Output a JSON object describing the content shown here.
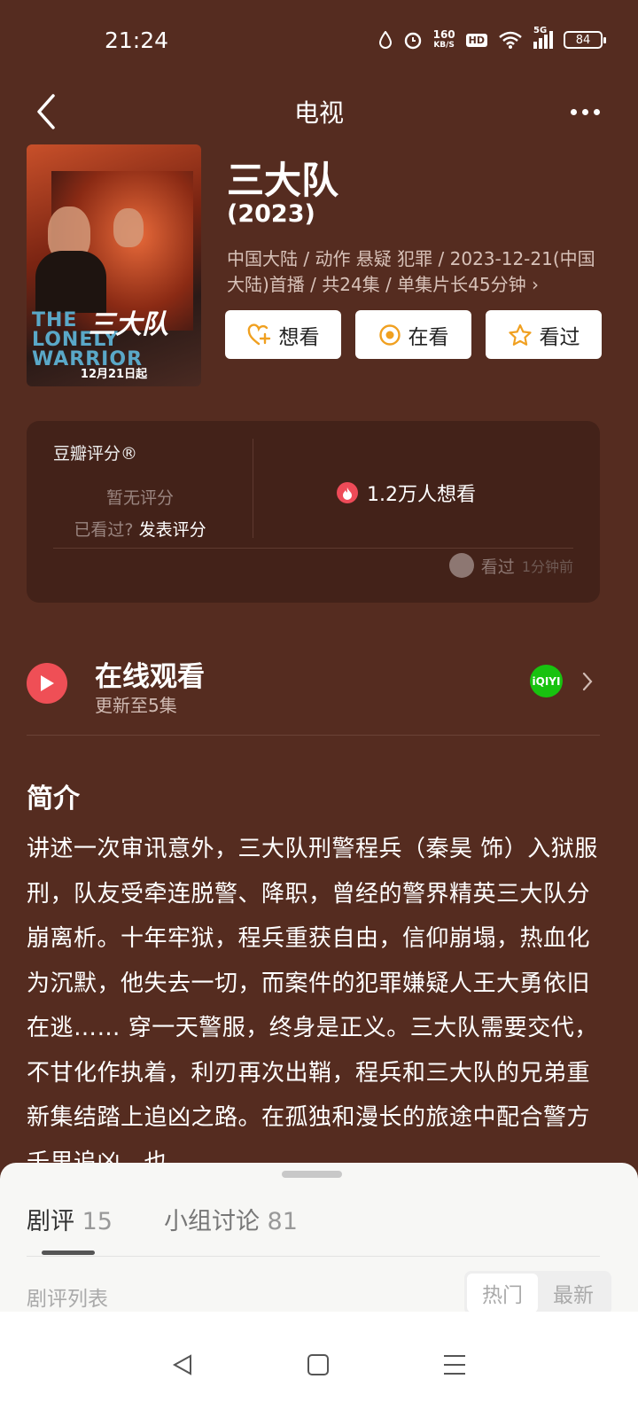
{
  "status_bar": {
    "time": "21:24",
    "net_speed_top": "160",
    "net_speed_bottom": "KB/S",
    "hd": "HD",
    "network": "5G",
    "battery": "84"
  },
  "nav": {
    "title": "电视",
    "back_icon": "chevron-left-icon",
    "more_icon": "more-dots-icon"
  },
  "poster": {
    "title_en_line1": "THE",
    "title_en_line2": "LONELY WARRIOR",
    "title_cn": "三大队",
    "date": "12月21日起"
  },
  "show": {
    "title": "三大队",
    "year": "(2023)",
    "meta": "中国大陆 / 动作 悬疑 犯罪 / 2023-12-21(中国大陆)首播 / 共24集 / 单集片长45分钟 ›"
  },
  "actions": {
    "want": "想看",
    "watching": "在看",
    "watched": "看过"
  },
  "rating": {
    "label": "豆瓣评分®",
    "no_rating": "暂无评分",
    "prompt": "已看过?",
    "prompt_link": "发表评分",
    "want_count": "1.2万人想看",
    "recent_action": "看过",
    "recent_time": "1分钟前"
  },
  "online": {
    "title": "在线观看",
    "subtitle": "更新至5集",
    "provider": "iQIYI"
  },
  "intro": {
    "title": "简介",
    "text": "讲述一次审讯意外，三大队刑警程兵（秦昊 饰）入狱服刑，队友受牵连脱警、降职，曾经的警界精英三大队分崩离析。十年牢狱，程兵重获自由，信仰崩塌，热血化为沉默，他失去一切，而案件的犯罪嫌疑人王大勇依旧在逃…… 穿一天警服，终身是正义。三大队需要交代，不甘化作执着，利刃再次出鞘，程兵和三大队的兄弟重新集结踏上追凶之路。在孤独和漫长的旅途中配合警方千里追凶，也"
  },
  "sheet": {
    "tabs": [
      {
        "label": "剧评",
        "count": "15"
      },
      {
        "label": "小组讨论",
        "count": "81"
      }
    ],
    "list_label": "剧评列表",
    "sort_hot": "热门",
    "sort_new": "最新"
  },
  "colors": {
    "background": "#552c20",
    "card": "#432219",
    "accent_red": "#ef4f56",
    "iqiyi_green": "#18c20f",
    "button_icon_orange": "#f0a020"
  }
}
